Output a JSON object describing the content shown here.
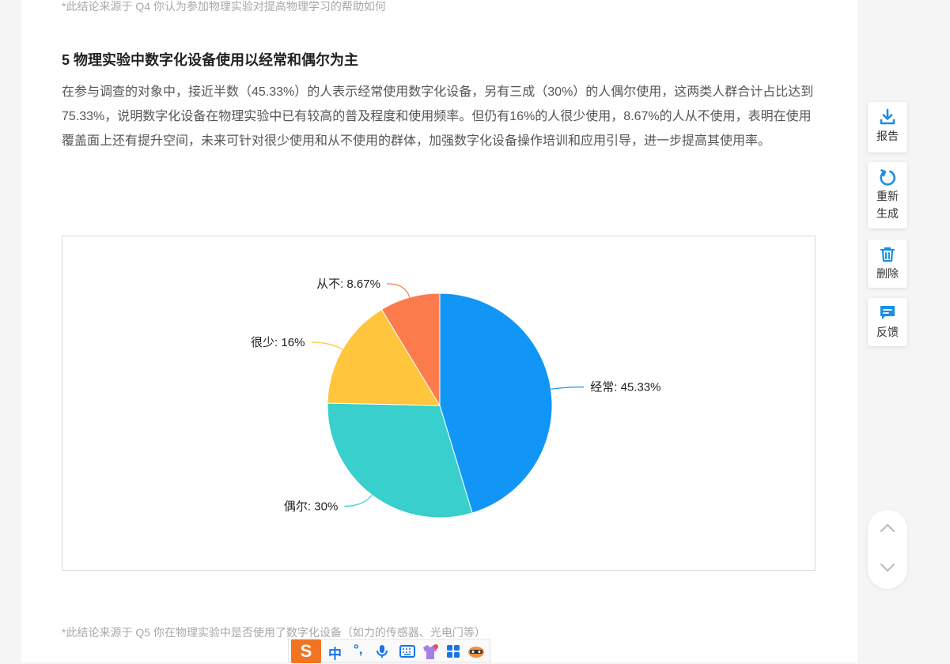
{
  "article": {
    "source_top": "*此结论来源于 Q4 你认为参加物理实验对提高物理学习的帮助如何",
    "section_title": "5 物理实验中数字化设备使用以经常和偶尔为主",
    "paragraph": "在参与调查的对象中，接近半数（45.33%）的人表示经常使用数字化设备，另有三成（30%）的人偶尔使用，这两类人群合计占比达到75.33%，说明数字化设备在物理实验中已有较高的普及程度和使用频率。但仍有16%的人很少使用，8.67%的人从不使用，表明在使用覆盖面上还有提升空间，未来可针对很少使用和从不使用的群体，加强数字化设备操作培训和应用引导，进一步提高其使用率。",
    "source_bottom": "*此结论来源于 Q5 你在物理实验中是否使用了数字化设备（如力的传感器、光电门等）"
  },
  "chart_data": {
    "type": "pie",
    "slices": [
      {
        "label": "经常: 45.33%",
        "value": 45.33,
        "color": "#1296f5"
      },
      {
        "label": "偶尔: 30%",
        "value": 30,
        "color": "#38cfcc"
      },
      {
        "label": "很少: 16%",
        "value": 16,
        "color": "#fec53d"
      },
      {
        "label": "从不: 8.67%",
        "value": 8.67,
        "color": "#fc7b4c"
      }
    ]
  },
  "sidebar": {
    "report_label": "报告",
    "regenerate_label": "重新\n生成",
    "delete_label": "删除",
    "feedback_label": "反馈"
  },
  "ime": {
    "logo": "S",
    "mode": "中",
    "punct": "°,"
  },
  "colors": {
    "accent": "#1a8fe3",
    "text": "#555555",
    "muted": "#a8a8a8"
  }
}
